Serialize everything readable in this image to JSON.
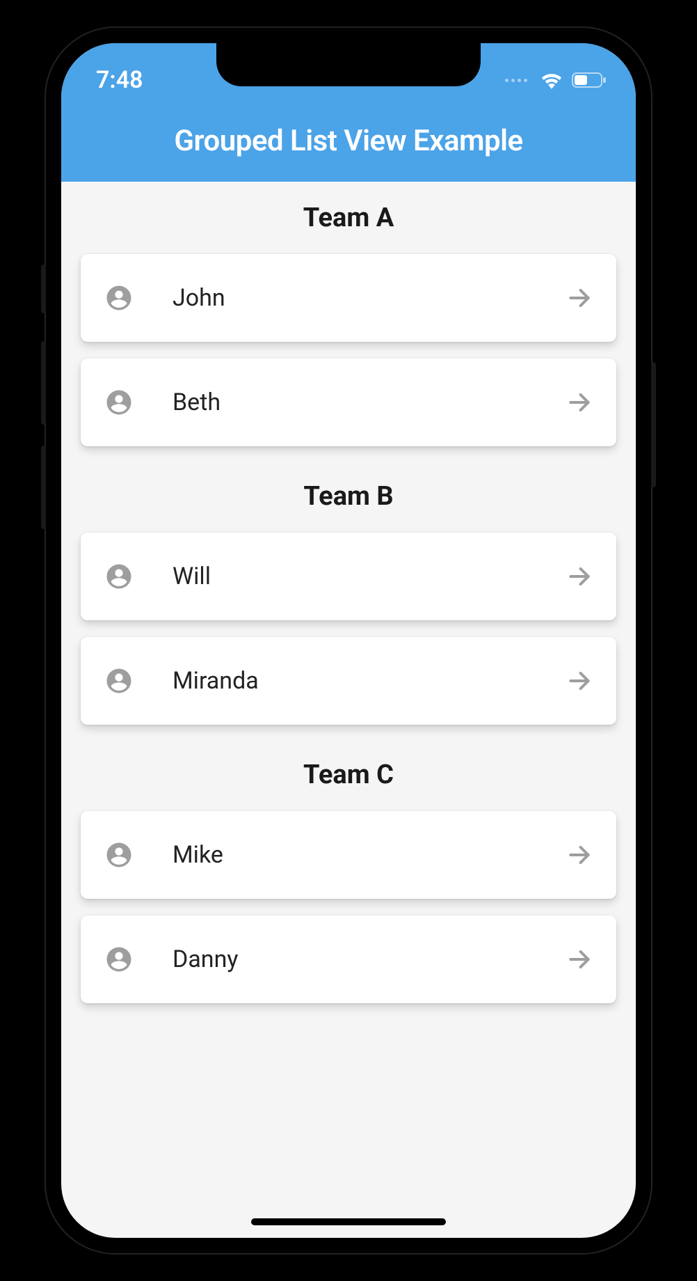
{
  "status_bar": {
    "time": "7:48"
  },
  "app_bar": {
    "title": "Grouped List View Example"
  },
  "groups": [
    {
      "header": "Team A",
      "members": [
        {
          "name": "John"
        },
        {
          "name": "Beth"
        }
      ]
    },
    {
      "header": "Team B",
      "members": [
        {
          "name": "Will"
        },
        {
          "name": "Miranda"
        }
      ]
    },
    {
      "header": "Team C",
      "members": [
        {
          "name": "Mike"
        },
        {
          "name": "Danny"
        }
      ]
    }
  ]
}
